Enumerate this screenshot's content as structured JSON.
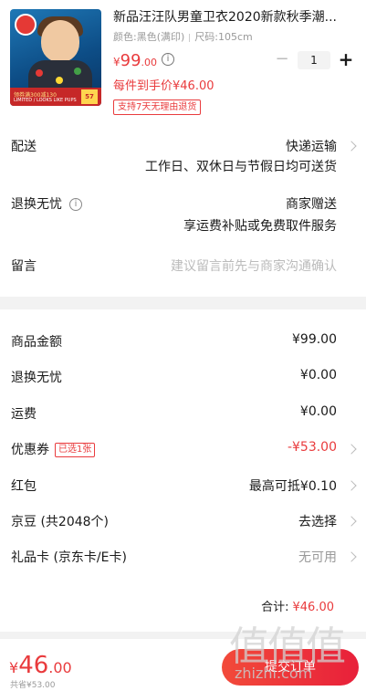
{
  "product": {
    "title": "新品汪汪队男童卫衣2020新款秋季潮...",
    "spec_color": "颜色:黑色(满印)",
    "spec_size": "尺码:105cm",
    "price_currency": "¥",
    "price_int": "99",
    "price_dec": ".00",
    "quantity": "1",
    "every_price": "每件到手价¥46.00",
    "return_badge": "支持7天无理由退货",
    "thumb_ribbon_text": "领券满300减130",
    "thumb_ribbon_sub": "LIMITED / LOOKS LIKE PUPS",
    "thumb_price": "57"
  },
  "delivery": {
    "label": "配送",
    "value_line1": "快递运输",
    "value_line2": "工作日、双休日与节假日均可送货"
  },
  "worry_free": {
    "label": "退换无忧",
    "info_icon": "i",
    "value_line1": "商家赠送",
    "value_line2": "享运费补贴或免费取件服务"
  },
  "note": {
    "label": "留言",
    "placeholder": "建议留言前先与商家沟通确认"
  },
  "summary": {
    "goods_amount_label": "商品金额",
    "goods_amount_value": "¥99.00",
    "worry_free_label": "退换无忧",
    "worry_free_value": "¥0.00",
    "shipping_label": "运费",
    "shipping_value": "¥0.00",
    "coupon_label": "优惠券",
    "coupon_badge": "已选1张",
    "coupon_value": "-¥53.00",
    "redpacket_label": "红包",
    "redpacket_value": "最高可抵¥0.10",
    "jingdou_label": "京豆 (共2048个)",
    "jingdou_value": "去选择",
    "giftcard_label": "礼品卡 (京东卡/E卡)",
    "giftcard_value": "无可用",
    "total_label": "合计:",
    "total_value": "¥46.00"
  },
  "bottom_bar": {
    "price_currency": "¥",
    "price_int": "46",
    "price_dec": ".00",
    "saving": "共省¥53.00",
    "submit_label": "提交订单"
  },
  "watermark": {
    "glyphs": "值值值",
    "url": "zhizhi.com"
  },
  "colors": {
    "accent": "#e93b3d",
    "muted": "#999999",
    "background": "#f2f2f2"
  }
}
